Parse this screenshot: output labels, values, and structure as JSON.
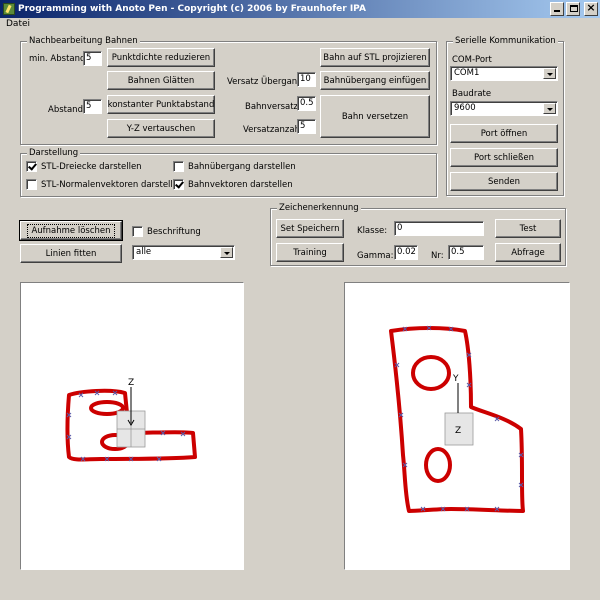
{
  "window": {
    "title": "Programming with Anoto Pen - Copyright (c) 2006 by Fraunhofer IPA"
  },
  "menu": {
    "datei": "Datei"
  },
  "nachbearbeitung": {
    "title": "Nachbearbeitung Bahnen",
    "min_abstand_label": "min. Abstand",
    "min_abstand_value": "5",
    "abstand_label": "Abstand",
    "abstand_value": "5",
    "btn_punktdichte": "Punktdichte reduzieren",
    "btn_glaetten": "Bahnen Glätten",
    "btn_konstant": "konstanter Punktabstand",
    "btn_yz": "Y-Z vertauschen",
    "versatz_uebergang_label": "Versatz Übergang",
    "versatz_uebergang_value": "10",
    "bahnversatz_label": "Bahnversatz",
    "bahnversatz_value": "0.5",
    "versatzanzahl_label": "Versatzanzahl",
    "versatzanzahl_value": "5",
    "btn_stl": "Bahn auf STL projizieren",
    "btn_uebergang": "Bahnübergang einfügen",
    "btn_versetzen": "Bahn versetzen"
  },
  "darstellung": {
    "title": "Darstellung",
    "stl_dreiecke": "STL-Dreiecke darstellen",
    "stl_dreiecke_checked": true,
    "stl_normal": "STL-Normalenvektoren darstellen",
    "stl_normal_checked": false,
    "bahnuebergang": "Bahnübergang darstellen",
    "bahnuebergang_checked": false,
    "bahnvektoren": "Bahnvektoren darstellen",
    "bahnvektoren_checked": true
  },
  "seriell": {
    "title": "Serielle Kommunikation",
    "com_port_label": "COM-Port",
    "com_port_value": "COM1",
    "baudrate_label": "Baudrate",
    "baudrate_value": "9600",
    "btn_oeffnen": "Port öffnen",
    "btn_schliessen": "Port schließen",
    "btn_senden": "Senden"
  },
  "aufnahme": {
    "btn_loeschen": "Aufnahme löschen",
    "btn_linien": "Linien fitten",
    "beschriftung_label": "Beschriftung",
    "beschriftung_checked": false,
    "filter_value": "alle"
  },
  "zeichenerkennung": {
    "title": "Zeichenerkennung",
    "btn_set_speichern": "Set Speichern",
    "btn_training": "Training",
    "klasse_label": "Klasse:",
    "klasse_value": "0",
    "gamma_label": "Gamma:",
    "gamma_value": "0.02",
    "nr_label": "Nr:",
    "nr_value": "0.5",
    "btn_test": "Test",
    "btn_abfrage": "Abfrage"
  },
  "views": {
    "left_axis_label": "Z",
    "right_axis_top_label": "Y",
    "right_axis_box_label": "Z",
    "stroke_color": "#cc0000",
    "marker_color": "#5a5aa8"
  }
}
